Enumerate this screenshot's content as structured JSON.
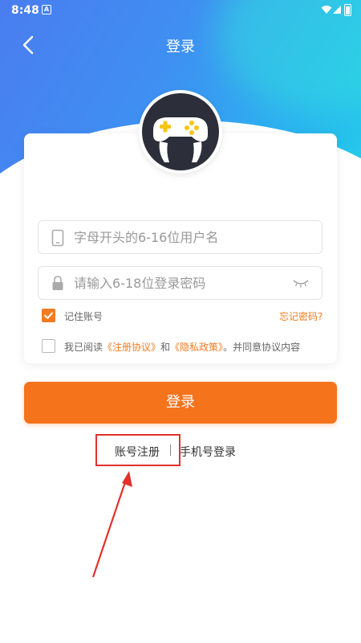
{
  "status_bar": {
    "time": "8:48",
    "notification_letter": "A"
  },
  "header": {
    "title": "登录"
  },
  "form": {
    "username_placeholder": "字母开头的6-16位用户名",
    "password_placeholder": "请输入6-18位登录密码",
    "remember_label": "记住账号",
    "remember_checked": true,
    "forgot_label": "忘记密码?",
    "agreement_prefix": "我已阅读",
    "agreement_terms": "《注册协议》",
    "agreement_and": "和",
    "agreement_privacy": "《隐私政策》",
    "agreement_suffix": "。并同意协议内容",
    "agreement_checked": false
  },
  "actions": {
    "login_button": "登录",
    "register_link": "账号注册",
    "phone_login_link": "手机号登录"
  },
  "colors": {
    "accent": "#f4731b",
    "gradient_start": "#4a7df0",
    "gradient_end": "#21d6e6",
    "annotation": "#e0312c"
  }
}
